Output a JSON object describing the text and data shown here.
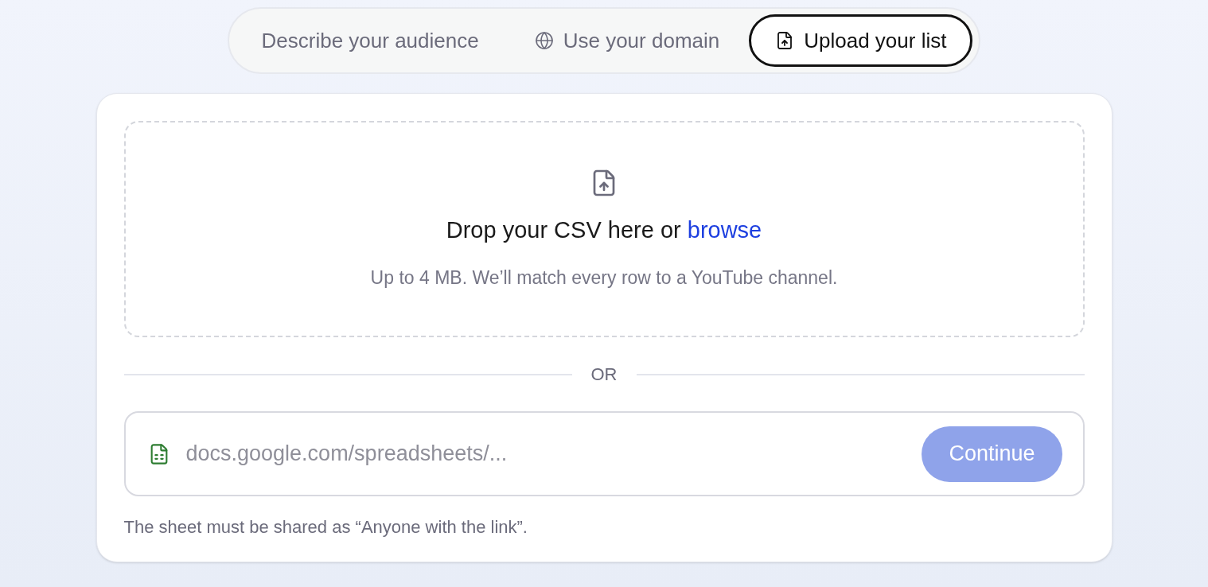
{
  "tabs": [
    {
      "label": "Describe your audience",
      "kind": "plain",
      "selected": false
    },
    {
      "label": "Use your domain",
      "kind": "globe",
      "selected": false
    },
    {
      "label": "Upload your list",
      "kind": "file",
      "selected": true
    }
  ],
  "dropzone": {
    "title": "Drop your CSV here or ",
    "link": "browse",
    "subtitle": "Up to 4 MB. We’ll match every row to a YouTube channel."
  },
  "divider": "OR",
  "sheet": {
    "placeholder": "docs.google.com/spreadsheets/...",
    "button": "Continue",
    "disabled": true
  },
  "hint": "The sheet must be shared as “Anyone with the link”."
}
